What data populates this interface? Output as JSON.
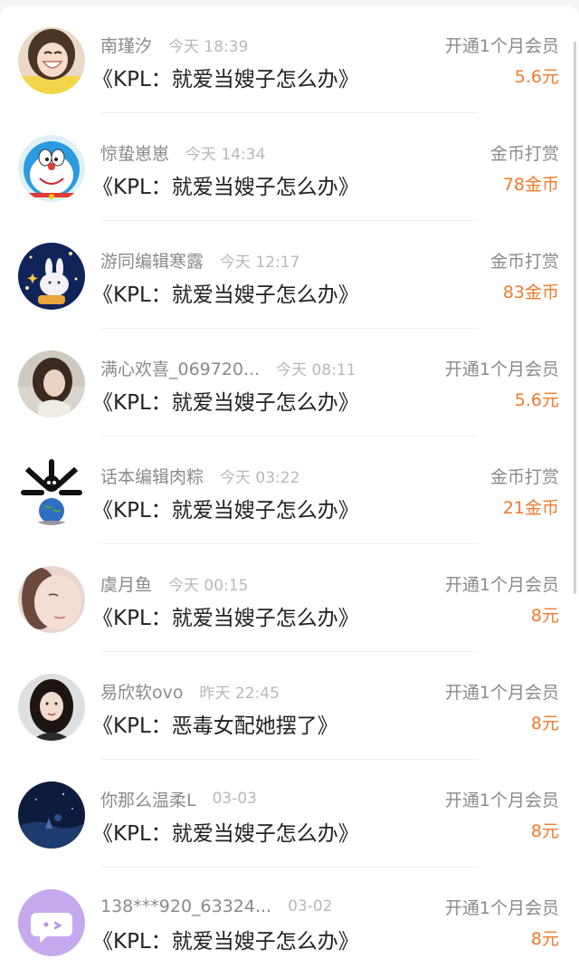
{
  "accent_color": "#ef7a2c",
  "items": [
    {
      "user": "南瑾汐",
      "time": "今天 18:39",
      "book": "《KPL：就爱当嫂子怎么办》",
      "action": "开通1个月会员",
      "amount": "5.6元",
      "avatar": "girl-smiling-avatar"
    },
    {
      "user": "惊蛰崽崽",
      "time": "今天 14:34",
      "book": "《KPL：就爱当嫂子怎么办》",
      "action": "金币打赏",
      "amount": "78金币",
      "avatar": "doraemon-avatar"
    },
    {
      "user": "游同编辑寒露",
      "time": "今天 12:17",
      "book": "《KPL：就爱当嫂子怎么办》",
      "action": "金币打赏",
      "amount": "83金币",
      "avatar": "night-bunny-avatar"
    },
    {
      "user": "满心欢喜_069720...",
      "time": "今天 08:11",
      "book": "《KPL：就爱当嫂子怎么办》",
      "action": "开通1个月会员",
      "amount": "5.6元",
      "avatar": "girl-portrait-avatar"
    },
    {
      "user": "话本编辑肉粽",
      "time": "今天 03:22",
      "book": "《KPL：就爱当嫂子怎么办》",
      "action": "金币打赏",
      "amount": "21金币",
      "avatar": "bone-globe-avatar"
    },
    {
      "user": "虞月鱼",
      "time": "今天 00:15",
      "book": "《KPL：就爱当嫂子怎么办》",
      "action": "开通1个月会员",
      "amount": "8元",
      "avatar": "soft-face-avatar"
    },
    {
      "user": "易欣软ovo",
      "time": "昨天 22:45",
      "book": "《KPL：恶毒女配她摆了》",
      "action": "开通1个月会员",
      "amount": "8元",
      "avatar": "dark-hair-girl-avatar"
    },
    {
      "user": "你那么温柔L",
      "time": "03-03",
      "book": "《KPL：就爱当嫂子怎么办》",
      "action": "开通1个月会员",
      "amount": "8元",
      "avatar": "night-scene-avatar"
    },
    {
      "user": "138***920_63324...",
      "time": "03-02",
      "book": "《KPL：就爱当嫂子怎么办》",
      "action": "开通1个月会员",
      "amount": "8元",
      "avatar": "chat-bubble-avatar"
    }
  ]
}
